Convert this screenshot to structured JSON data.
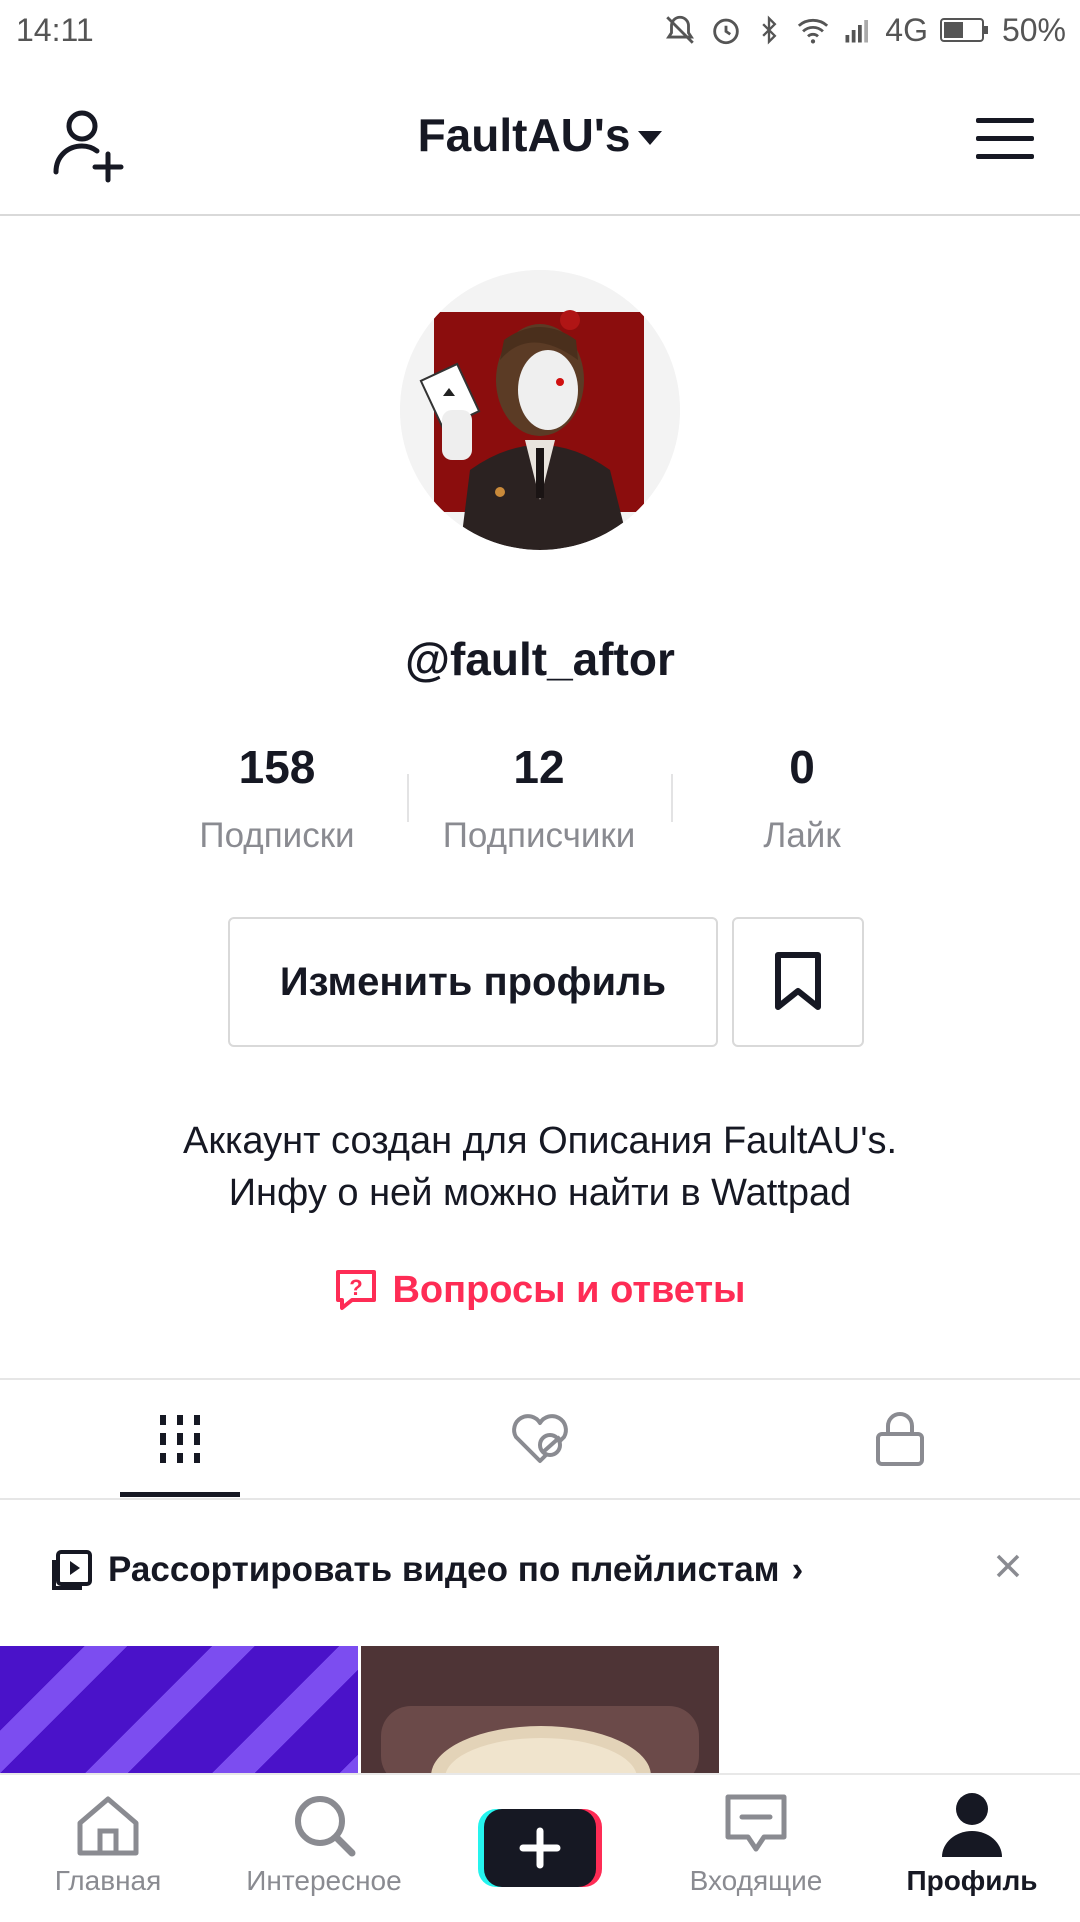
{
  "status_bar": {
    "time": "14:11",
    "network": "4G",
    "battery": "50%"
  },
  "header": {
    "title": "FaultAU's"
  },
  "profile": {
    "username": "@fault_aftor",
    "stats": [
      {
        "value": "158",
        "label": "Подписки"
      },
      {
        "value": "12",
        "label": "Подписчики"
      },
      {
        "value": "0",
        "label": "Лайк"
      }
    ],
    "edit_button": "Изменить профиль",
    "bio_line1": "Аккаунт создан для Описания FaultAU's.",
    "bio_line2": "Инфу о ней можно найти в Wattpad",
    "qa_link": "Вопросы и ответы"
  },
  "tabs": [
    {
      "icon": "videos-grid-icon",
      "active": true
    },
    {
      "icon": "liked-hidden-icon",
      "active": false
    },
    {
      "icon": "lock-icon",
      "active": false
    }
  ],
  "playlist_banner": {
    "text": "Рассортировать видео по плейлистам",
    "chevron": "›"
  },
  "bottom_nav": [
    {
      "label": "Главная",
      "icon": "home-icon"
    },
    {
      "label": "Интересное",
      "icon": "search-icon"
    },
    {
      "label": "",
      "icon": "plus-icon"
    },
    {
      "label": "Входящие",
      "icon": "inbox-icon"
    },
    {
      "label": "Профиль",
      "icon": "profile-icon",
      "active": true
    }
  ],
  "colors": {
    "accent": "#fe2c55",
    "text": "#161823",
    "secondary": "#8a8b91"
  }
}
